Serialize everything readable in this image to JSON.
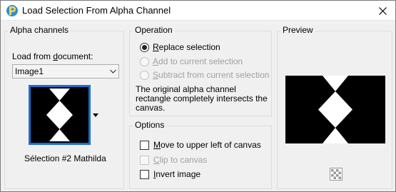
{
  "window": {
    "title": "Load Selection From Alpha Channel",
    "app_icon": "paintshop-pro-logo",
    "close_icon": "close-icon"
  },
  "alpha_channels": {
    "group_label": "Alpha channels",
    "load_from_label_before": "Load from ",
    "load_from_label_mnemonic": "d",
    "load_from_label_after": "ocument:",
    "document_value": "Image1",
    "dropdown_icon": "chevron-down-icon",
    "thumbnail_dropdown_icon": "triangle-down-icon",
    "channel_name": "Sélection #2 Mathilda"
  },
  "operation": {
    "group_label": "Operation",
    "options": [
      {
        "mnemonic": "R",
        "rest": "eplace selection",
        "checked": true,
        "enabled": true
      },
      {
        "mnemonic": "A",
        "rest": "dd to current selection",
        "checked": false,
        "enabled": false
      },
      {
        "mnemonic": "S",
        "rest": "ubtract from current selection",
        "checked": false,
        "enabled": false
      }
    ],
    "note": "The original alpha channel rectangle completely intersects the canvas."
  },
  "options": {
    "group_label": "Options",
    "items": [
      {
        "mnemonic": "M",
        "rest": "ove to upper left of canvas",
        "checked": false,
        "enabled": true
      },
      {
        "mnemonic": "C",
        "rest": "lip to canvas",
        "checked": false,
        "enabled": false
      },
      {
        "mnemonic": "I",
        "rest": "nvert image",
        "checked": false,
        "enabled": true
      }
    ]
  },
  "preview": {
    "group_label": "Preview",
    "transparency_icon": "checkerboard-icon"
  },
  "colors": {
    "selection_border": "#1a6fd1",
    "mask_black": "#000000",
    "mask_white": "#ffffff"
  }
}
